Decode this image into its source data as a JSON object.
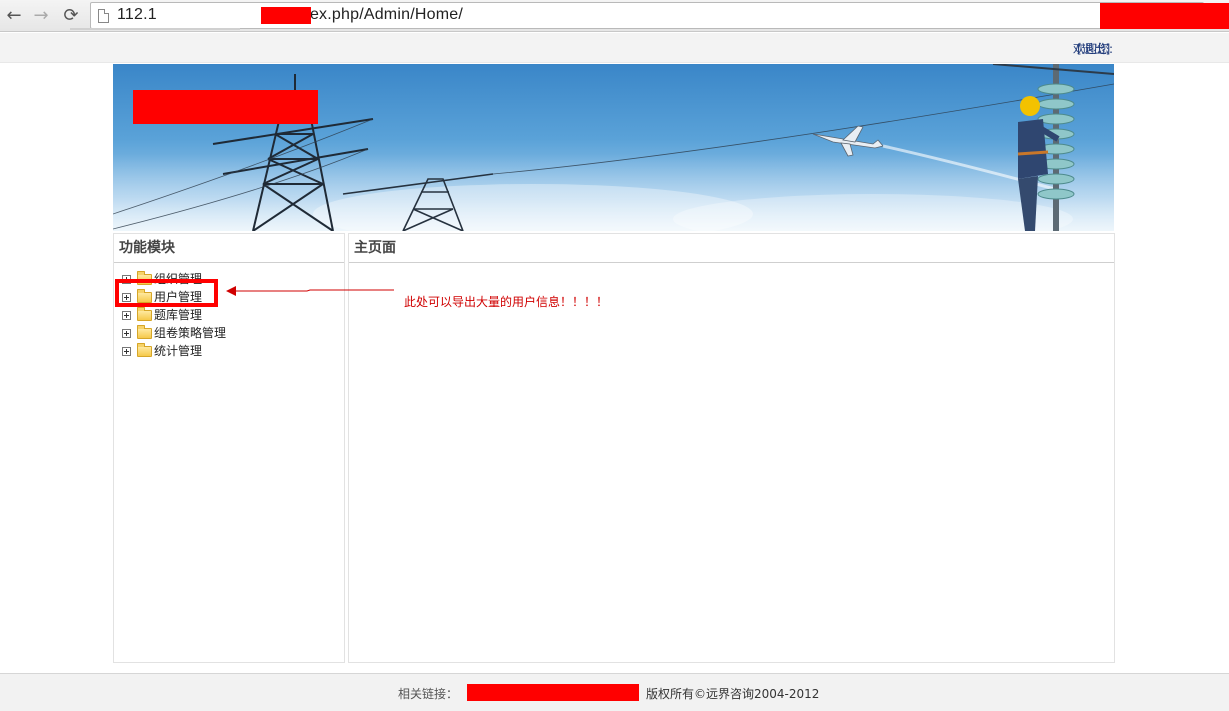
{
  "browser": {
    "nav_back": "←",
    "nav_forward": "→",
    "reload": "⟳",
    "url": "112.1                               dex.php/Admin/Home/"
  },
  "header": {
    "welcome": "欢迎您:",
    "logout": "[退出]"
  },
  "sidebar": {
    "title": "功能模块",
    "items": [
      {
        "label": "组织管理"
      },
      {
        "label": "用户管理"
      },
      {
        "label": "题库管理"
      },
      {
        "label": "组卷策略管理"
      },
      {
        "label": "统计管理"
      }
    ]
  },
  "main": {
    "title": "主页面",
    "annotation": "此处可以导出大量的用户信息！！！！"
  },
  "footer": {
    "links_label": "相关链接：",
    "copyright": "版权所有©远界咨询2004-2012"
  },
  "colors": {
    "redaction": "#ff0000",
    "link": "#1f3a7a",
    "annotation": "#d00000"
  },
  "icons": [
    "back-arrow-icon",
    "forward-arrow-icon",
    "reload-icon",
    "page-icon",
    "expand-plus-icon",
    "folder-icon",
    "annotation-arrow-icon"
  ]
}
